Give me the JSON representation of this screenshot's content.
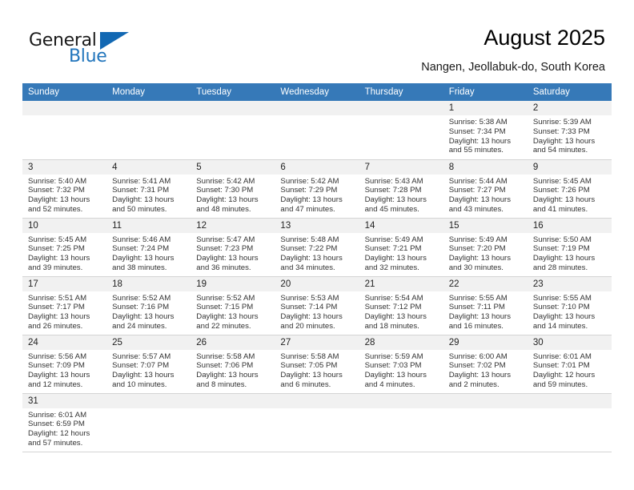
{
  "brand": {
    "name_part1": "General",
    "name_part2": "Blue",
    "accent_color": "#2175bc",
    "flag_color": "#1268b3"
  },
  "header": {
    "title": "August 2025",
    "subtitle": "Nangen, Jeollabuk-do, South Korea"
  },
  "calendar": {
    "header_bg": "#3679b8",
    "daynum_bg": "#f1f1f1",
    "weekdays": [
      "Sunday",
      "Monday",
      "Tuesday",
      "Wednesday",
      "Thursday",
      "Friday",
      "Saturday"
    ],
    "weeks": [
      [
        {
          "day": "",
          "blank": true
        },
        {
          "day": "",
          "blank": true
        },
        {
          "day": "",
          "blank": true
        },
        {
          "day": "",
          "blank": true
        },
        {
          "day": "",
          "blank": true
        },
        {
          "day": "1",
          "sunrise": "Sunrise: 5:38 AM",
          "sunset": "Sunset: 7:34 PM",
          "daylight1": "Daylight: 13 hours",
          "daylight2": "and 55 minutes."
        },
        {
          "day": "2",
          "sunrise": "Sunrise: 5:39 AM",
          "sunset": "Sunset: 7:33 PM",
          "daylight1": "Daylight: 13 hours",
          "daylight2": "and 54 minutes."
        }
      ],
      [
        {
          "day": "3",
          "sunrise": "Sunrise: 5:40 AM",
          "sunset": "Sunset: 7:32 PM",
          "daylight1": "Daylight: 13 hours",
          "daylight2": "and 52 minutes."
        },
        {
          "day": "4",
          "sunrise": "Sunrise: 5:41 AM",
          "sunset": "Sunset: 7:31 PM",
          "daylight1": "Daylight: 13 hours",
          "daylight2": "and 50 minutes."
        },
        {
          "day": "5",
          "sunrise": "Sunrise: 5:42 AM",
          "sunset": "Sunset: 7:30 PM",
          "daylight1": "Daylight: 13 hours",
          "daylight2": "and 48 minutes."
        },
        {
          "day": "6",
          "sunrise": "Sunrise: 5:42 AM",
          "sunset": "Sunset: 7:29 PM",
          "daylight1": "Daylight: 13 hours",
          "daylight2": "and 47 minutes."
        },
        {
          "day": "7",
          "sunrise": "Sunrise: 5:43 AM",
          "sunset": "Sunset: 7:28 PM",
          "daylight1": "Daylight: 13 hours",
          "daylight2": "and 45 minutes."
        },
        {
          "day": "8",
          "sunrise": "Sunrise: 5:44 AM",
          "sunset": "Sunset: 7:27 PM",
          "daylight1": "Daylight: 13 hours",
          "daylight2": "and 43 minutes."
        },
        {
          "day": "9",
          "sunrise": "Sunrise: 5:45 AM",
          "sunset": "Sunset: 7:26 PM",
          "daylight1": "Daylight: 13 hours",
          "daylight2": "and 41 minutes."
        }
      ],
      [
        {
          "day": "10",
          "sunrise": "Sunrise: 5:45 AM",
          "sunset": "Sunset: 7:25 PM",
          "daylight1": "Daylight: 13 hours",
          "daylight2": "and 39 minutes."
        },
        {
          "day": "11",
          "sunrise": "Sunrise: 5:46 AM",
          "sunset": "Sunset: 7:24 PM",
          "daylight1": "Daylight: 13 hours",
          "daylight2": "and 38 minutes."
        },
        {
          "day": "12",
          "sunrise": "Sunrise: 5:47 AM",
          "sunset": "Sunset: 7:23 PM",
          "daylight1": "Daylight: 13 hours",
          "daylight2": "and 36 minutes."
        },
        {
          "day": "13",
          "sunrise": "Sunrise: 5:48 AM",
          "sunset": "Sunset: 7:22 PM",
          "daylight1": "Daylight: 13 hours",
          "daylight2": "and 34 minutes."
        },
        {
          "day": "14",
          "sunrise": "Sunrise: 5:49 AM",
          "sunset": "Sunset: 7:21 PM",
          "daylight1": "Daylight: 13 hours",
          "daylight2": "and 32 minutes."
        },
        {
          "day": "15",
          "sunrise": "Sunrise: 5:49 AM",
          "sunset": "Sunset: 7:20 PM",
          "daylight1": "Daylight: 13 hours",
          "daylight2": "and 30 minutes."
        },
        {
          "day": "16",
          "sunrise": "Sunrise: 5:50 AM",
          "sunset": "Sunset: 7:19 PM",
          "daylight1": "Daylight: 13 hours",
          "daylight2": "and 28 minutes."
        }
      ],
      [
        {
          "day": "17",
          "sunrise": "Sunrise: 5:51 AM",
          "sunset": "Sunset: 7:17 PM",
          "daylight1": "Daylight: 13 hours",
          "daylight2": "and 26 minutes."
        },
        {
          "day": "18",
          "sunrise": "Sunrise: 5:52 AM",
          "sunset": "Sunset: 7:16 PM",
          "daylight1": "Daylight: 13 hours",
          "daylight2": "and 24 minutes."
        },
        {
          "day": "19",
          "sunrise": "Sunrise: 5:52 AM",
          "sunset": "Sunset: 7:15 PM",
          "daylight1": "Daylight: 13 hours",
          "daylight2": "and 22 minutes."
        },
        {
          "day": "20",
          "sunrise": "Sunrise: 5:53 AM",
          "sunset": "Sunset: 7:14 PM",
          "daylight1": "Daylight: 13 hours",
          "daylight2": "and 20 minutes."
        },
        {
          "day": "21",
          "sunrise": "Sunrise: 5:54 AM",
          "sunset": "Sunset: 7:12 PM",
          "daylight1": "Daylight: 13 hours",
          "daylight2": "and 18 minutes."
        },
        {
          "day": "22",
          "sunrise": "Sunrise: 5:55 AM",
          "sunset": "Sunset: 7:11 PM",
          "daylight1": "Daylight: 13 hours",
          "daylight2": "and 16 minutes."
        },
        {
          "day": "23",
          "sunrise": "Sunrise: 5:55 AM",
          "sunset": "Sunset: 7:10 PM",
          "daylight1": "Daylight: 13 hours",
          "daylight2": "and 14 minutes."
        }
      ],
      [
        {
          "day": "24",
          "sunrise": "Sunrise: 5:56 AM",
          "sunset": "Sunset: 7:09 PM",
          "daylight1": "Daylight: 13 hours",
          "daylight2": "and 12 minutes."
        },
        {
          "day": "25",
          "sunrise": "Sunrise: 5:57 AM",
          "sunset": "Sunset: 7:07 PM",
          "daylight1": "Daylight: 13 hours",
          "daylight2": "and 10 minutes."
        },
        {
          "day": "26",
          "sunrise": "Sunrise: 5:58 AM",
          "sunset": "Sunset: 7:06 PM",
          "daylight1": "Daylight: 13 hours",
          "daylight2": "and 8 minutes."
        },
        {
          "day": "27",
          "sunrise": "Sunrise: 5:58 AM",
          "sunset": "Sunset: 7:05 PM",
          "daylight1": "Daylight: 13 hours",
          "daylight2": "and 6 minutes."
        },
        {
          "day": "28",
          "sunrise": "Sunrise: 5:59 AM",
          "sunset": "Sunset: 7:03 PM",
          "daylight1": "Daylight: 13 hours",
          "daylight2": "and 4 minutes."
        },
        {
          "day": "29",
          "sunrise": "Sunrise: 6:00 AM",
          "sunset": "Sunset: 7:02 PM",
          "daylight1": "Daylight: 13 hours",
          "daylight2": "and 2 minutes."
        },
        {
          "day": "30",
          "sunrise": "Sunrise: 6:01 AM",
          "sunset": "Sunset: 7:01 PM",
          "daylight1": "Daylight: 12 hours",
          "daylight2": "and 59 minutes."
        }
      ],
      [
        {
          "day": "31",
          "sunrise": "Sunrise: 6:01 AM",
          "sunset": "Sunset: 6:59 PM",
          "daylight1": "Daylight: 12 hours",
          "daylight2": "and 57 minutes."
        },
        {
          "day": "",
          "blank": true
        },
        {
          "day": "",
          "blank": true
        },
        {
          "day": "",
          "blank": true
        },
        {
          "day": "",
          "blank": true
        },
        {
          "day": "",
          "blank": true
        },
        {
          "day": "",
          "blank": true
        }
      ]
    ]
  }
}
